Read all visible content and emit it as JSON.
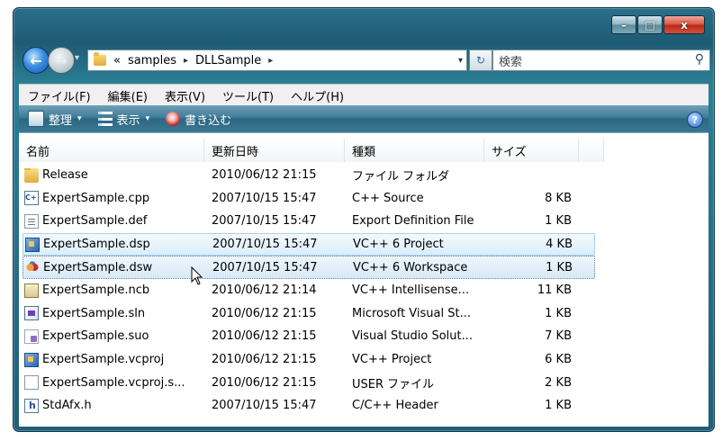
{
  "window": {
    "minimize_glyph": "–",
    "maximize_glyph": "□",
    "close_glyph": "x"
  },
  "nav": {
    "back_glyph": "←",
    "forward_glyph": "→",
    "history_glyph": "▾",
    "breadcrumb_prefix": "«",
    "breadcrumbs": [
      "samples",
      "DLLSample"
    ],
    "crumb_separator": "▸",
    "dropdown_glyph": "▾",
    "refresh_glyph": "↻",
    "search_placeholder": "検索",
    "search_icon": "⚲"
  },
  "menu": [
    "ファイル(F)",
    "編集(E)",
    "表示(V)",
    "ツール(T)",
    "ヘルプ(H)"
  ],
  "commands": {
    "organize": "整理",
    "view": "表示",
    "burn": "書き込む",
    "dropdown_glyph": "▾",
    "help_glyph": "?"
  },
  "columns": [
    "名前",
    "更新日時",
    "種類",
    "サイズ"
  ],
  "files": [
    {
      "name": "Release",
      "date": "2010/06/12 21:15",
      "type": "ファイル フォルダ",
      "size": "",
      "icon": "folder-icon"
    },
    {
      "name": "ExpertSample.cpp",
      "date": "2007/10/15 15:47",
      "type": "C++ Source",
      "size": "8 KB",
      "icon": "cpp-file-icon"
    },
    {
      "name": "ExpertSample.def",
      "date": "2007/10/15 15:47",
      "type": "Export Definition File",
      "size": "1 KB",
      "icon": "document-icon"
    },
    {
      "name": "ExpertSample.dsp",
      "date": "2007/10/15 15:47",
      "type": "VC++ 6 Project",
      "size": "4 KB",
      "icon": "vc-project-icon"
    },
    {
      "name": "ExpertSample.dsw",
      "date": "2007/10/15 15:47",
      "type": "VC++ 6 Workspace",
      "size": "1 KB",
      "icon": "vc-workspace-icon"
    },
    {
      "name": "ExpertSample.ncb",
      "date": "2010/06/12 21:14",
      "type": "VC++ Intellisense...",
      "size": "11 KB",
      "icon": "intellisense-db-icon"
    },
    {
      "name": "ExpertSample.sln",
      "date": "2010/06/12 21:15",
      "type": "Microsoft Visual St...",
      "size": "1 KB",
      "icon": "solution-icon"
    },
    {
      "name": "ExpertSample.suo",
      "date": "2010/06/12 21:15",
      "type": "Visual Studio Solut...",
      "size": "7 KB",
      "icon": "solution-options-icon"
    },
    {
      "name": "ExpertSample.vcproj",
      "date": "2010/06/12 21:15",
      "type": "VC++ Project",
      "size": "6 KB",
      "icon": "vc-project-icon"
    },
    {
      "name": "ExpertSample.vcproj.s...",
      "date": "2010/06/12 21:15",
      "type": "USER ファイル",
      "size": "2 KB",
      "icon": "blank-file-icon"
    },
    {
      "name": "StdAfx.h",
      "date": "2007/10/15 15:47",
      "type": "C/C++ Header",
      "size": "1 KB",
      "icon": "header-file-icon"
    }
  ]
}
